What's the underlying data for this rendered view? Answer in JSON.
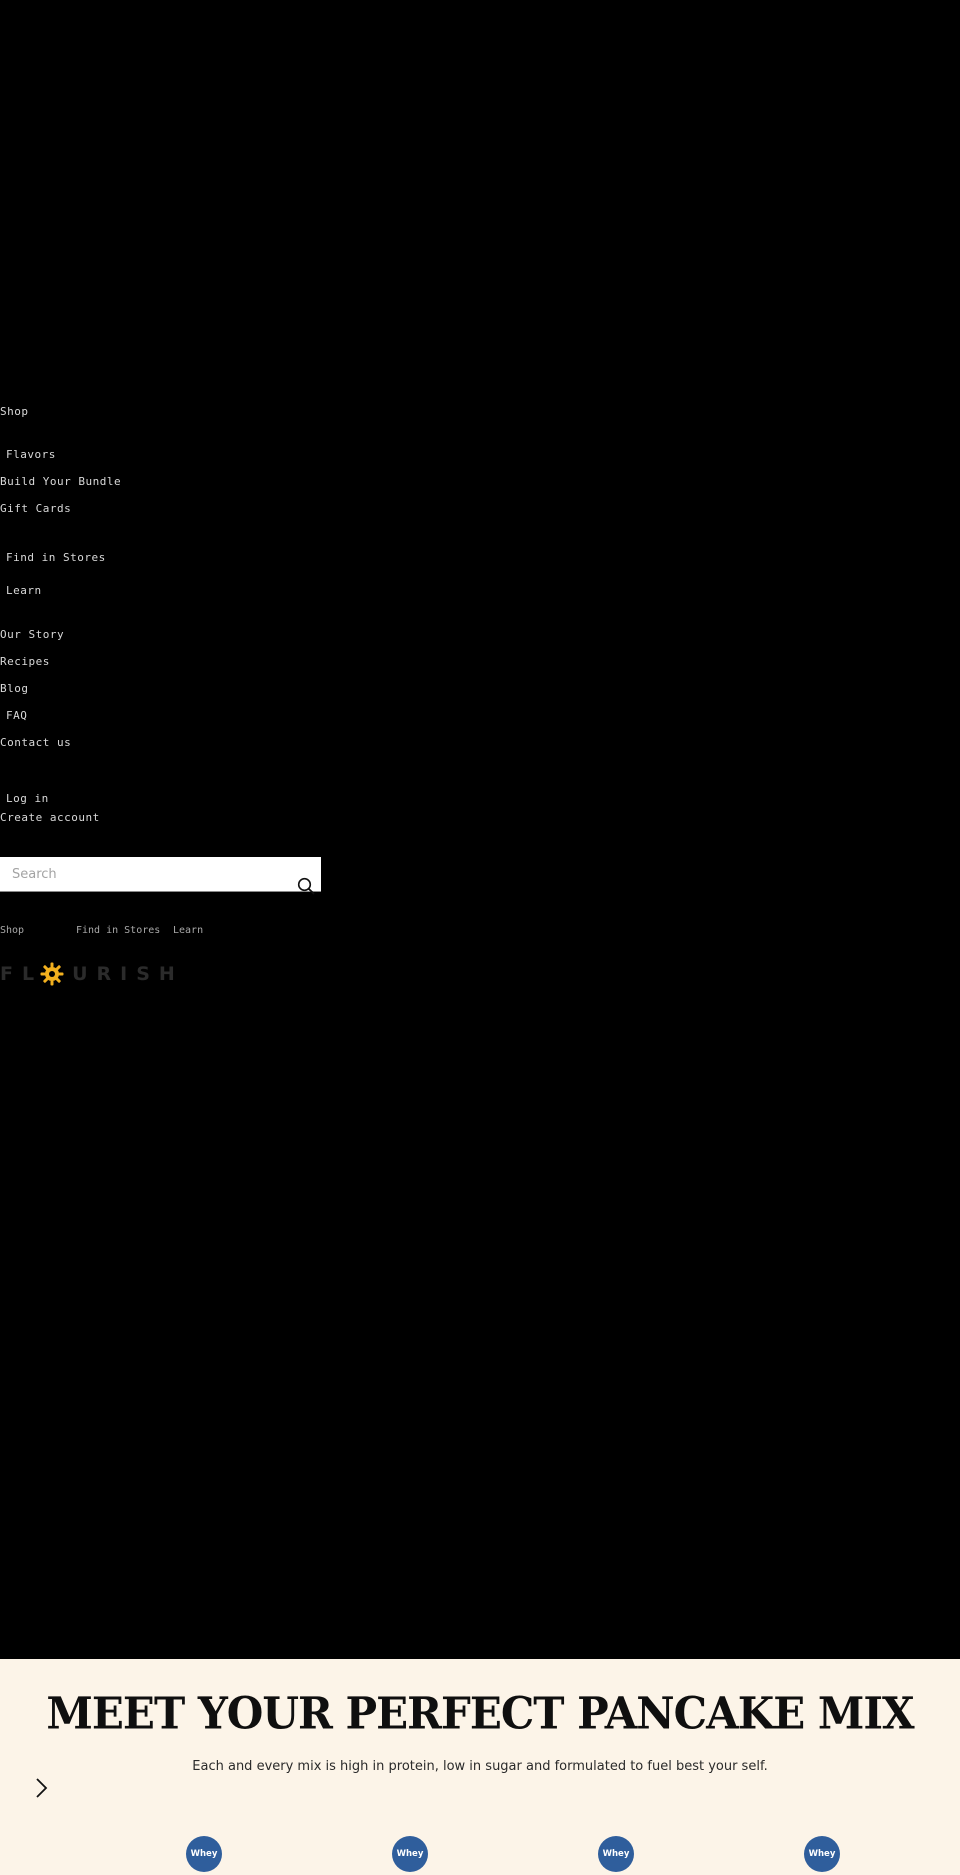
{
  "menu": {
    "items": [
      {
        "label": "Shop",
        "indent": false
      },
      {
        "label": "Flavors",
        "indent": true
      },
      {
        "label": "Build Your Bundle",
        "indent": true
      },
      {
        "label": "Gift Cards",
        "indent": false
      },
      {
        "label": "Find in Stores",
        "indent": true
      },
      {
        "label": "Learn",
        "indent": true
      },
      {
        "label": "Our Story",
        "indent": false
      },
      {
        "label": "Recipes",
        "indent": false
      },
      {
        "label": "Blog",
        "indent": false
      },
      {
        "label": "FAQ",
        "indent": true
      },
      {
        "label": "Contact us",
        "indent": false
      }
    ],
    "account": {
      "login": "Log in",
      "create": "Create account"
    }
  },
  "search": {
    "placeholder": "Search",
    "value": ""
  },
  "bottom_nav": {
    "items": [
      "Shop",
      "Find in Stores",
      "Learn"
    ]
  },
  "logo": {
    "text_before": "FL",
    "text_after": "URISH",
    "sun_color": "#f2b01e"
  },
  "hero": {
    "title": "MEET YOUR PERFECT PANCAKE MIX",
    "subtitle": "Each and every mix is high in protein, low in sugar and formulated to fuel best your self."
  },
  "products": {
    "badges": [
      "Whey",
      "Whey",
      "Whey",
      "Whey"
    ],
    "badge_color": "#2f5e9c"
  },
  "colors": {
    "dark_bg": "#000000",
    "cream_bg": "#fcf4e8"
  }
}
